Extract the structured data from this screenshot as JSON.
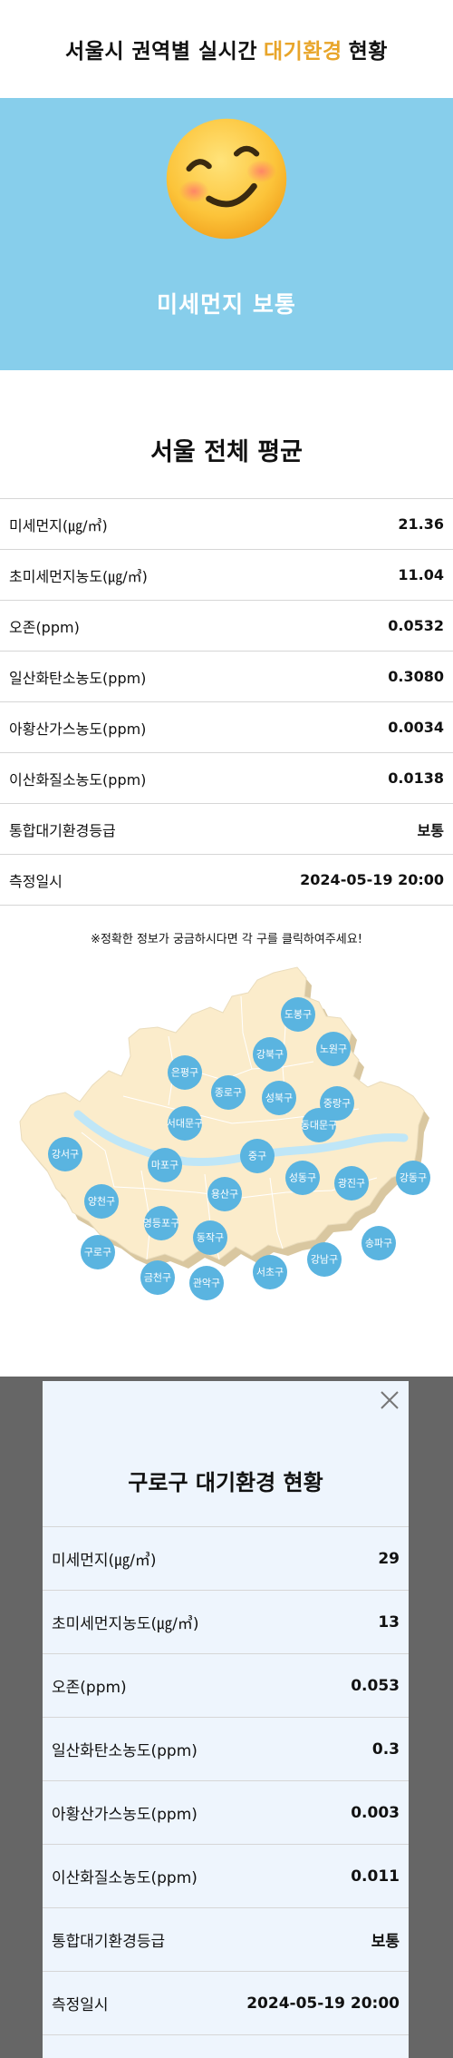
{
  "header": {
    "title_pre": "서울시 권역별 실시간",
    "title_accent": "대기환경",
    "title_post": "현황",
    "accent_color": "#e8a52a"
  },
  "hero": {
    "icon": "smiling-face-emoji",
    "status": "미세먼지 보통",
    "bg_color": "#87ceeb"
  },
  "average": {
    "title": "서울 전체 평균",
    "rows": [
      {
        "label": "미세먼지(㎍/㎥)",
        "value": "21.36"
      },
      {
        "label": "초미세먼지농도(㎍/㎥)",
        "value": "11.04"
      },
      {
        "label": "오존(ppm)",
        "value": "0.0532"
      },
      {
        "label": "일산화탄소농도(ppm)",
        "value": "0.3080"
      },
      {
        "label": "아황산가스농도(ppm)",
        "value": "0.0034"
      },
      {
        "label": "이산화질소농도(ppm)",
        "value": "0.0138"
      },
      {
        "label": "통합대기환경등급",
        "value": "보통"
      },
      {
        "label": "측정일시",
        "value": "2024-05-19 20:00"
      }
    ]
  },
  "notice": "※정확한 정보가 궁금하시다면 각 구를 클릭하여주세요!",
  "map": {
    "districts": [
      "도봉구",
      "노원구",
      "강북구",
      "은평구",
      "종로구",
      "성북구",
      "중랑구",
      "서대문구",
      "동대문구",
      "강서구",
      "마포구",
      "중구",
      "성동구",
      "광진구",
      "강동구",
      "양천구",
      "용산구",
      "영등포구",
      "동작구",
      "구로구",
      "송파구",
      "강남구",
      "서초구",
      "금천구",
      "관악구"
    ],
    "marker_color": "#5ab4e0"
  },
  "modal": {
    "title": "구로구 대기환경 현황",
    "close_icon": "close-icon",
    "rows": [
      {
        "label": "미세먼지(㎍/㎥)",
        "value": "29"
      },
      {
        "label": "초미세먼지농도(㎍/㎥)",
        "value": "13"
      },
      {
        "label": "오존(ppm)",
        "value": "0.053"
      },
      {
        "label": "일산화탄소농도(ppm)",
        "value": "0.3"
      },
      {
        "label": "아황산가스농도(ppm)",
        "value": "0.003"
      },
      {
        "label": "이산화질소농도(ppm)",
        "value": "0.011"
      },
      {
        "label": "통합대기환경등급",
        "value": "보통"
      },
      {
        "label": "측정일시",
        "value": "2024-05-19 20:00"
      }
    ]
  }
}
